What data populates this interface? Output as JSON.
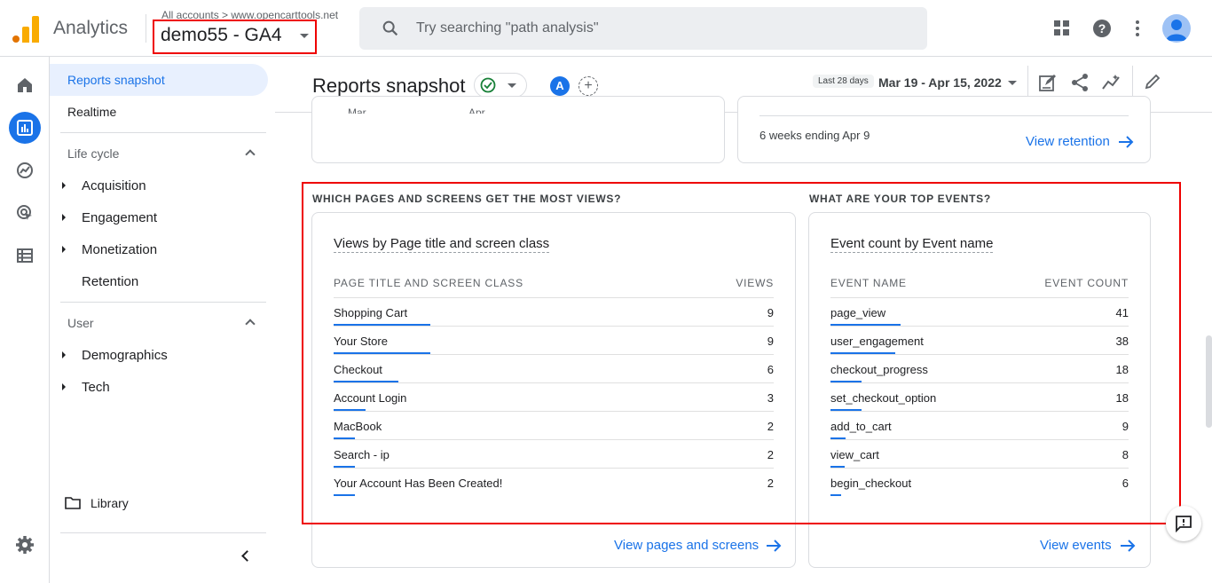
{
  "topbar": {
    "brand": "Analytics",
    "breadcrumb": "All accounts > www.opencarttools.net",
    "property": "demo55 - GA4",
    "search_placeholder": "Try searching \"path analysis\""
  },
  "nav": {
    "reports_snapshot": "Reports snapshot",
    "realtime": "Realtime",
    "lifecycle": "Life cycle",
    "acquisition": "Acquisition",
    "engagement": "Engagement",
    "monetization": "Monetization",
    "retention": "Retention",
    "user": "User",
    "demographics": "Demographics",
    "tech": "Tech",
    "library": "Library"
  },
  "header": {
    "title": "Reports snapshot",
    "badge": "A",
    "plus": "+",
    "range_chip": "Last 28 days",
    "date_range": "Mar 19 - Apr 15, 2022"
  },
  "prev_cards": {
    "left_axis": [
      "Mar",
      "Apr"
    ],
    "right_note": "6 weeks ending Apr 9",
    "right_link": "View retention"
  },
  "pages_section": {
    "heading": "WHICH PAGES AND SCREENS GET THE MOST VIEWS?",
    "card_title": "Views by Page title and screen class",
    "col_label": "PAGE TITLE AND SCREEN CLASS",
    "col_value": "VIEWS",
    "rows": [
      {
        "label": "Shopping Cart",
        "value": "9",
        "share": 1.0
      },
      {
        "label": "Your Store",
        "value": "9",
        "share": 1.0
      },
      {
        "label": "Checkout",
        "value": "6",
        "share": 0.67
      },
      {
        "label": "Account Login",
        "value": "3",
        "share": 0.33
      },
      {
        "label": "MacBook",
        "value": "2",
        "share": 0.22
      },
      {
        "label": "Search - ip",
        "value": "2",
        "share": 0.22
      },
      {
        "label": "Your Account Has Been Created!",
        "value": "2",
        "share": 0.22
      }
    ],
    "link": "View pages and screens"
  },
  "events_section": {
    "heading": "WHAT ARE YOUR TOP EVENTS?",
    "card_title": "Event count by Event name",
    "col_label": "EVENT NAME",
    "col_value": "EVENT COUNT",
    "rows": [
      {
        "label": "page_view",
        "value": "41",
        "share": 1.0
      },
      {
        "label": "user_engagement",
        "value": "38",
        "share": 0.93
      },
      {
        "label": "checkout_progress",
        "value": "18",
        "share": 0.44
      },
      {
        "label": "set_checkout_option",
        "value": "18",
        "share": 0.44
      },
      {
        "label": "add_to_cart",
        "value": "9",
        "share": 0.22
      },
      {
        "label": "view_cart",
        "value": "8",
        "share": 0.2
      },
      {
        "label": "begin_checkout",
        "value": "6",
        "share": 0.15
      }
    ],
    "link": "View events"
  },
  "colors": {
    "accent": "#1a73e8",
    "highlight_box": "#e00000",
    "active_nav": "#e8f0fe",
    "logo_orange": "#f9ab00",
    "logo_dark": "#e37400"
  }
}
